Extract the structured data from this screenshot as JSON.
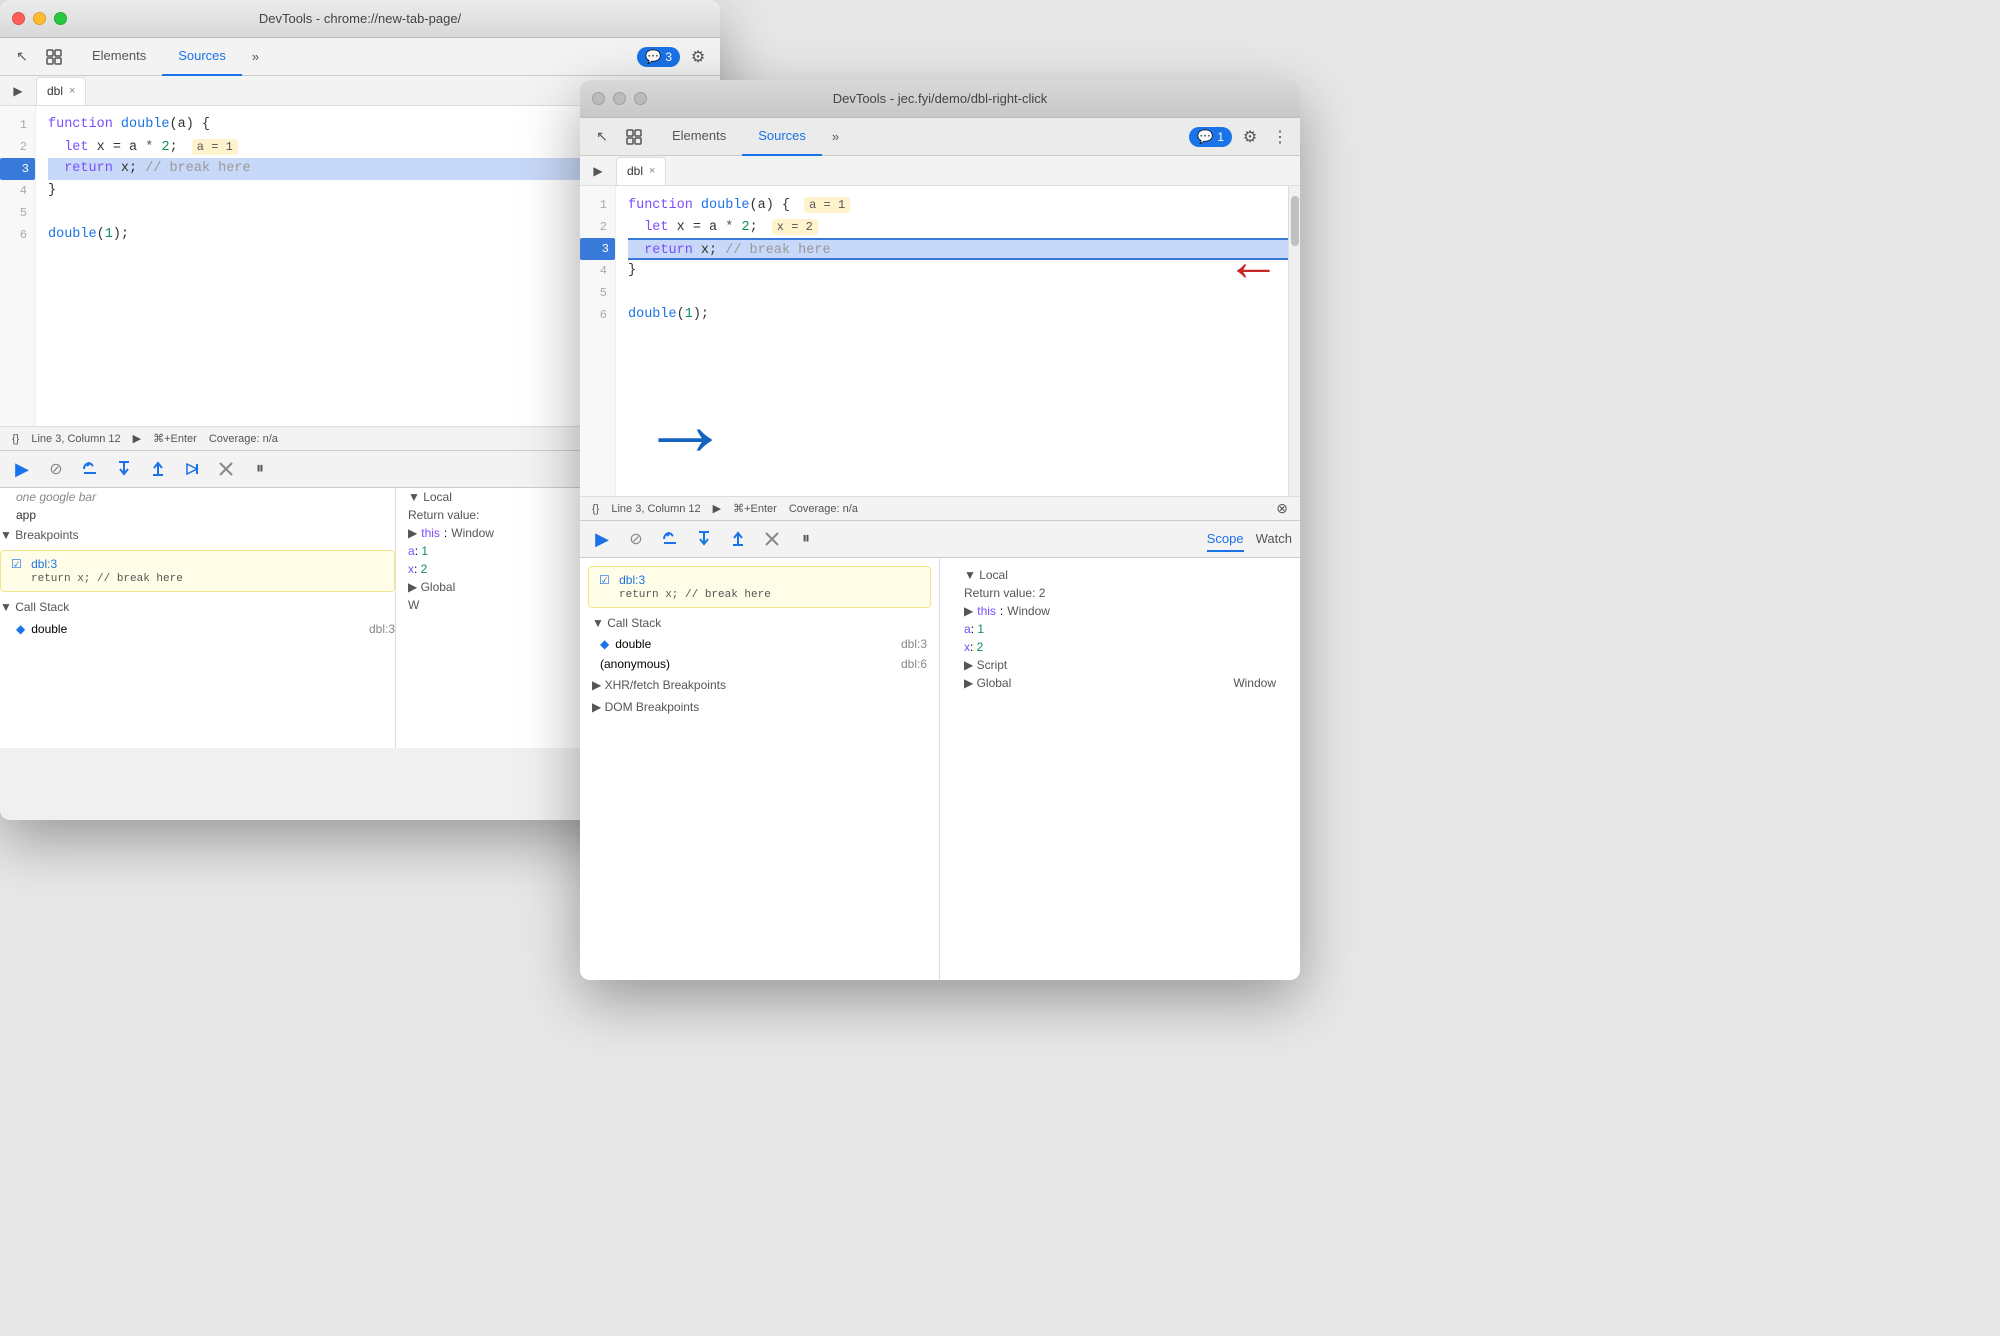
{
  "window_left": {
    "title": "DevTools - chrome://new-tab-page/",
    "tabs": [
      "Elements",
      "Sources"
    ],
    "active_tab": "Sources",
    "badge": "3",
    "file_tab": "dbl",
    "code": {
      "lines": [
        {
          "num": 1,
          "content": "function double(a) {",
          "type": "normal"
        },
        {
          "num": 2,
          "content": "  let x = a * 2;",
          "type": "normal"
        },
        {
          "num": 3,
          "content": "  return x; // break here",
          "type": "current"
        },
        {
          "num": 4,
          "content": "}",
          "type": "normal"
        },
        {
          "num": 5,
          "content": "",
          "type": "normal"
        },
        {
          "num": 6,
          "content": "double(1);",
          "type": "normal"
        }
      ]
    },
    "status_bar": {
      "format": "{}",
      "position": "Line 3, Column 12",
      "run": "⌘+Enter",
      "coverage": "Coverage: n/a"
    },
    "debug": {
      "scope_tab": "Scope",
      "watch_tab": "Watch"
    },
    "left_panel": {
      "google_bar": "one google bar",
      "app": "app",
      "breakpoints_label": "▼ Breakpoints",
      "breakpoint": {
        "label": "dbl:3",
        "code": "return x; // break here"
      },
      "call_stack_label": "▼ Call Stack",
      "call_stack_items": [
        {
          "name": "double",
          "location": "dbl:3"
        }
      ]
    },
    "right_panel": {
      "local_label": "▼ Local",
      "return_value": "Return value:",
      "this": "this: Window",
      "a_val": "a: 1",
      "x_val": "x: 2",
      "global_label": "▶ Global",
      "global_val": "W"
    }
  },
  "window_right": {
    "title": "DevTools - jec.fyi/demo/dbl-right-click",
    "tabs": [
      "Elements",
      "Sources"
    ],
    "active_tab": "Sources",
    "badge": "1",
    "file_tab": "dbl",
    "code": {
      "lines": [
        {
          "num": 1,
          "content": "function double(a) {",
          "type": "normal"
        },
        {
          "num": 2,
          "content": "  let x = a * 2;",
          "type": "normal"
        },
        {
          "num": 3,
          "content": "  return x; // break here",
          "type": "current"
        },
        {
          "num": 4,
          "content": "}",
          "type": "normal"
        },
        {
          "num": 5,
          "content": "",
          "type": "normal"
        },
        {
          "num": 6,
          "content": "double(1);",
          "type": "normal"
        }
      ],
      "inline_a": "a = 1",
      "inline_x": "x = 2"
    },
    "status_bar": {
      "format": "{}",
      "position": "Line 3, Column 12",
      "run": "⌘+Enter",
      "coverage": "Coverage: n/a"
    },
    "debug": {
      "scope_tab": "Scope",
      "watch_tab": "Watch"
    },
    "left_panel": {
      "breakpoint": {
        "label": "dbl:3",
        "code": "return x; // break here"
      },
      "call_stack_label": "▼ Call Stack",
      "call_stack_items": [
        {
          "name": "double",
          "location": "dbl:3"
        },
        {
          "name": "(anonymous)",
          "location": "dbl:6"
        }
      ],
      "xhr_label": "▶ XHR/fetch Breakpoints",
      "dom_label": "▶ DOM Breakpoints"
    },
    "right_panel": {
      "local_label": "▼ Local",
      "return_value": "Return value: 2",
      "this": "this: Window",
      "a_val": "a: 1",
      "x_val": "x: 2",
      "script_label": "▶ Script",
      "global_label": "▶ Global",
      "global_val": "Window"
    }
  },
  "arrows": {
    "blue": "→",
    "red": "←"
  },
  "icons": {
    "cursor": "↖",
    "layers": "⊞",
    "chevron": "»",
    "gear": "⚙",
    "chat": "💬",
    "play": "▶",
    "pause_step": "⏸",
    "step_over": "↷",
    "step_into": "↓",
    "step_out": "↑",
    "continue": "▶",
    "deactivate": "⚡",
    "format": "{}"
  }
}
